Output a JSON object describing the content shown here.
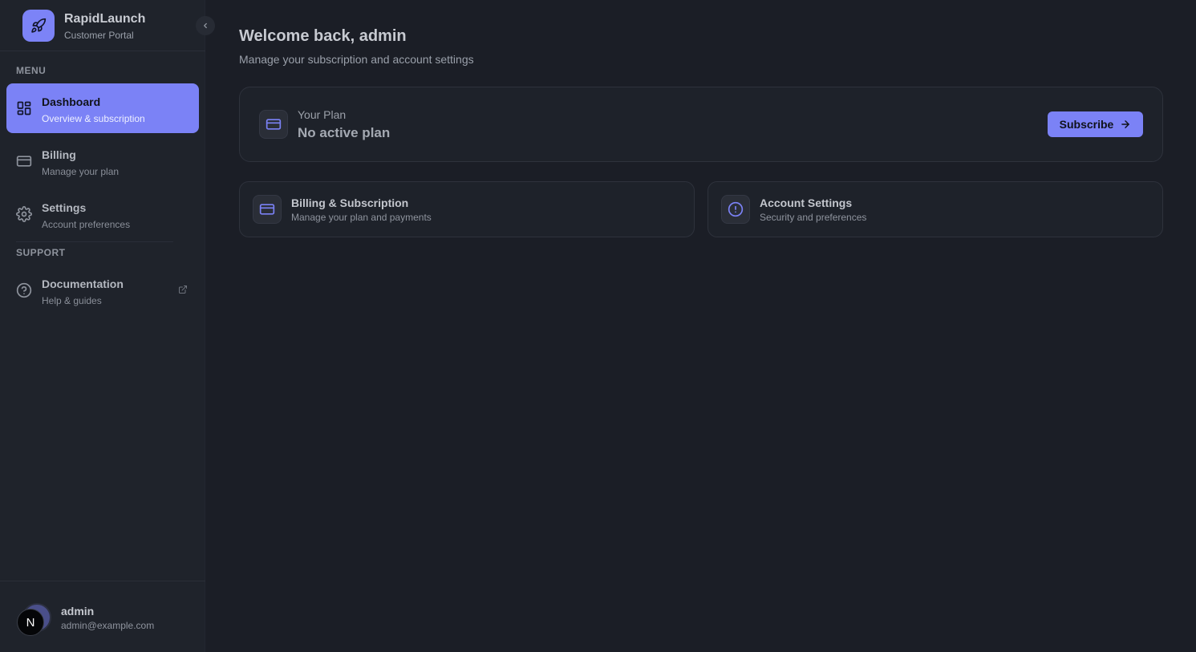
{
  "brand": {
    "name": "RapidLaunch",
    "subtitle": "Customer Portal"
  },
  "sidebar": {
    "menu_label": "MENU",
    "support_label": "SUPPORT",
    "items": [
      {
        "title": "Dashboard",
        "subtitle": "Overview & subscription",
        "icon": "dashboard-grid-icon",
        "active": true
      },
      {
        "title": "Billing",
        "subtitle": "Manage your plan",
        "icon": "credit-card-icon",
        "active": false
      },
      {
        "title": "Settings",
        "subtitle": "Account preferences",
        "icon": "gear-icon",
        "active": false
      }
    ],
    "support_items": [
      {
        "title": "Documentation",
        "subtitle": "Help & guides",
        "icon": "help-circle-icon",
        "external": true
      }
    ]
  },
  "user": {
    "name": "admin",
    "email": "admin@example.com",
    "avatar_letter": "N"
  },
  "main": {
    "title": "Welcome back, admin",
    "subtitle": "Manage your subscription and account settings",
    "plan": {
      "label": "Your Plan",
      "value": "No active plan",
      "button": "Subscribe"
    },
    "cards": [
      {
        "title": "Billing & Subscription",
        "subtitle": "Manage your plan and payments",
        "icon": "credit-card-icon"
      },
      {
        "title": "Account Settings",
        "subtitle": "Security and preferences",
        "icon": "alert-circle-icon"
      }
    ]
  },
  "colors": {
    "accent": "#7b82f6",
    "background": "#1b1e26",
    "sidebar": "#1f232b",
    "card": "#1e222a"
  }
}
